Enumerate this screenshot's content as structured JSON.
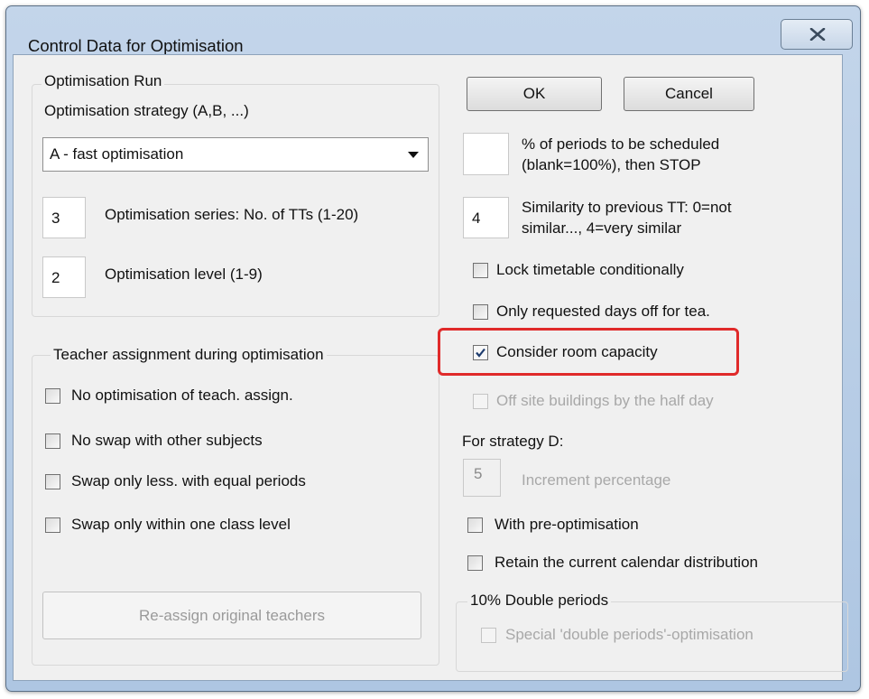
{
  "window": {
    "title": "Control Data for Optimisation"
  },
  "optimisation_run": {
    "legend": "Optimisation Run",
    "strategy_label": "Optimisation strategy (A,B, ...)",
    "strategy_value": "A - fast optimisation",
    "series_value": "3",
    "series_label": "Optimisation series: No. of TTs (1-20)",
    "level_value": "2",
    "level_label": "Optimisation level (1-9)"
  },
  "teacher_assignment": {
    "legend": "Teacher assignment during optimisation",
    "options": [
      {
        "label": "No optimisation of teach. assign.",
        "checked": false
      },
      {
        "label": "No swap with other subjects",
        "checked": false
      },
      {
        "label": "Swap only less. with equal periods",
        "checked": false
      },
      {
        "label": "Swap only within one class level",
        "checked": false
      }
    ],
    "reassign_button": "Re-assign original teachers"
  },
  "buttons": {
    "ok": "OK",
    "cancel": "Cancel"
  },
  "right": {
    "periods_value": "",
    "periods_label_1": "% of periods to be scheduled",
    "periods_label_2": "(blank=100%), then STOP",
    "similarity_value": "4",
    "similarity_label_1": "Similarity to previous TT: 0=not",
    "similarity_label_2": "similar..., 4=very similar",
    "lock_label": "Lock timetable conditionally",
    "days_off_label": "Only requested days off for tea.",
    "room_capacity_label": "Consider room capacity",
    "room_capacity_checked": true,
    "off_site_label": "Off site buildings by the half day",
    "strategy_d_label": "For strategy D:",
    "increment_value": "5",
    "increment_label": "Increment percentage",
    "pre_opt_label": "With pre-optimisation",
    "retain_label": "Retain the current calendar distribution"
  },
  "double_periods": {
    "legend": "10% Double periods",
    "special_label": "Special 'double periods'-optimisation"
  },
  "colors": {
    "highlight": "#e02a2a",
    "dialog_bg": "#f0f0f0",
    "frame": "#b9cfe7"
  },
  "icons": {
    "close": "close-x-icon",
    "dropdown": "dropdown-arrow-icon",
    "check": "checkmark-icon"
  }
}
